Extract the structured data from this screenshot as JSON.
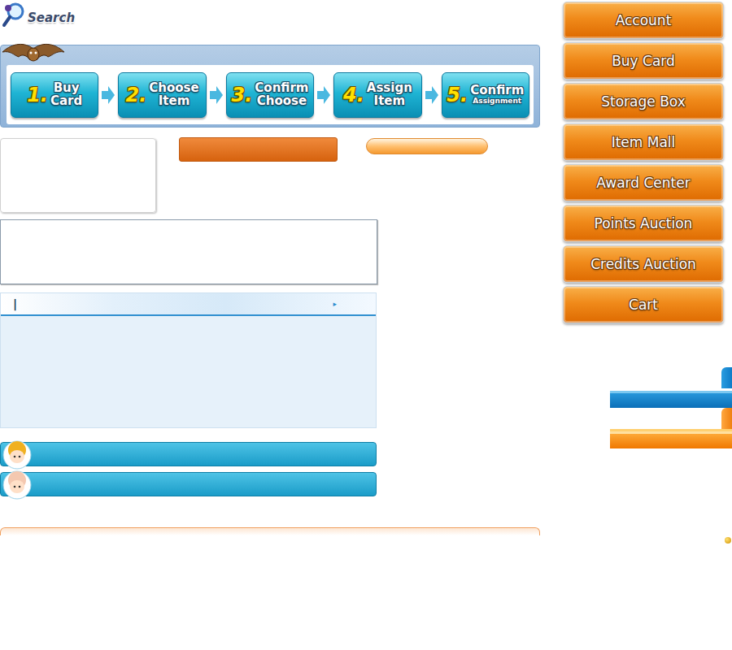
{
  "search": {
    "label": "Search"
  },
  "steps": [
    {
      "number": "1.",
      "lines": [
        "Buy",
        "Card"
      ],
      "kind": "normal"
    },
    {
      "number": "2.",
      "lines": [
        "Choose",
        "Item"
      ],
      "kind": "normal"
    },
    {
      "number": "3.",
      "lines": [
        "Confirm",
        "Choose"
      ],
      "kind": "normal"
    },
    {
      "number": "4.",
      "lines": [
        "Assign",
        "Item"
      ],
      "kind": "normal"
    },
    {
      "number": "5.",
      "lines": [
        "Confirm",
        "Assignment"
      ],
      "kind": "compact"
    }
  ],
  "panel": {
    "header_mark": "|",
    "header_arrow": "▸"
  },
  "sidebar": {
    "items": [
      "Account",
      "Buy Card",
      "Storage Box",
      "Item Mall",
      "Award Center",
      "Points Auction",
      "Credits Auction",
      "Cart"
    ]
  }
}
